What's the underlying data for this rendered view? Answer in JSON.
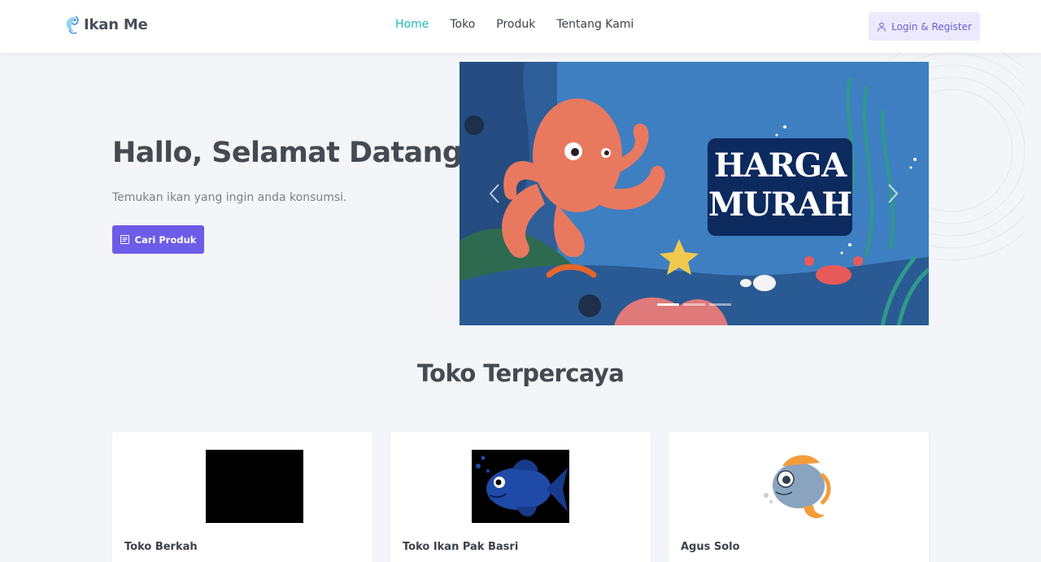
{
  "brand": {
    "name": "Ikan Me",
    "icon": "fish-logo-icon"
  },
  "nav": {
    "items": [
      {
        "label": "Home",
        "active": true
      },
      {
        "label": "Toko",
        "active": false
      },
      {
        "label": "Produk",
        "active": false
      },
      {
        "label": "Tentang Kami",
        "active": false
      }
    ],
    "login_label": "Login & Register",
    "login_icon": "user-icon"
  },
  "hero": {
    "title": "Hallo, Selamat Datang",
    "subtitle": "Temukan ikan yang ingin anda konsumsi.",
    "cta_label": "Cari Produk",
    "cta_icon": "list-icon"
  },
  "carousel": {
    "badge_line1": "HARGA",
    "badge_line2": "MURAH",
    "slide_count": 3,
    "active_slide": 1
  },
  "stores": {
    "title": "Toko Terpercaya",
    "items": [
      {
        "name": "Toko Berkah",
        "image": "black-placeholder-image"
      },
      {
        "name": "Toko Ikan Pak Basri",
        "image": "blue-fish-image"
      },
      {
        "name": "Agus Solo",
        "image": "cartoon-fish-image"
      }
    ]
  },
  "colors": {
    "accent": "#6c5ce7",
    "nav_active": "#1fb7b7",
    "login_bg": "#ebe9fb",
    "background": "#f3f5f8"
  }
}
